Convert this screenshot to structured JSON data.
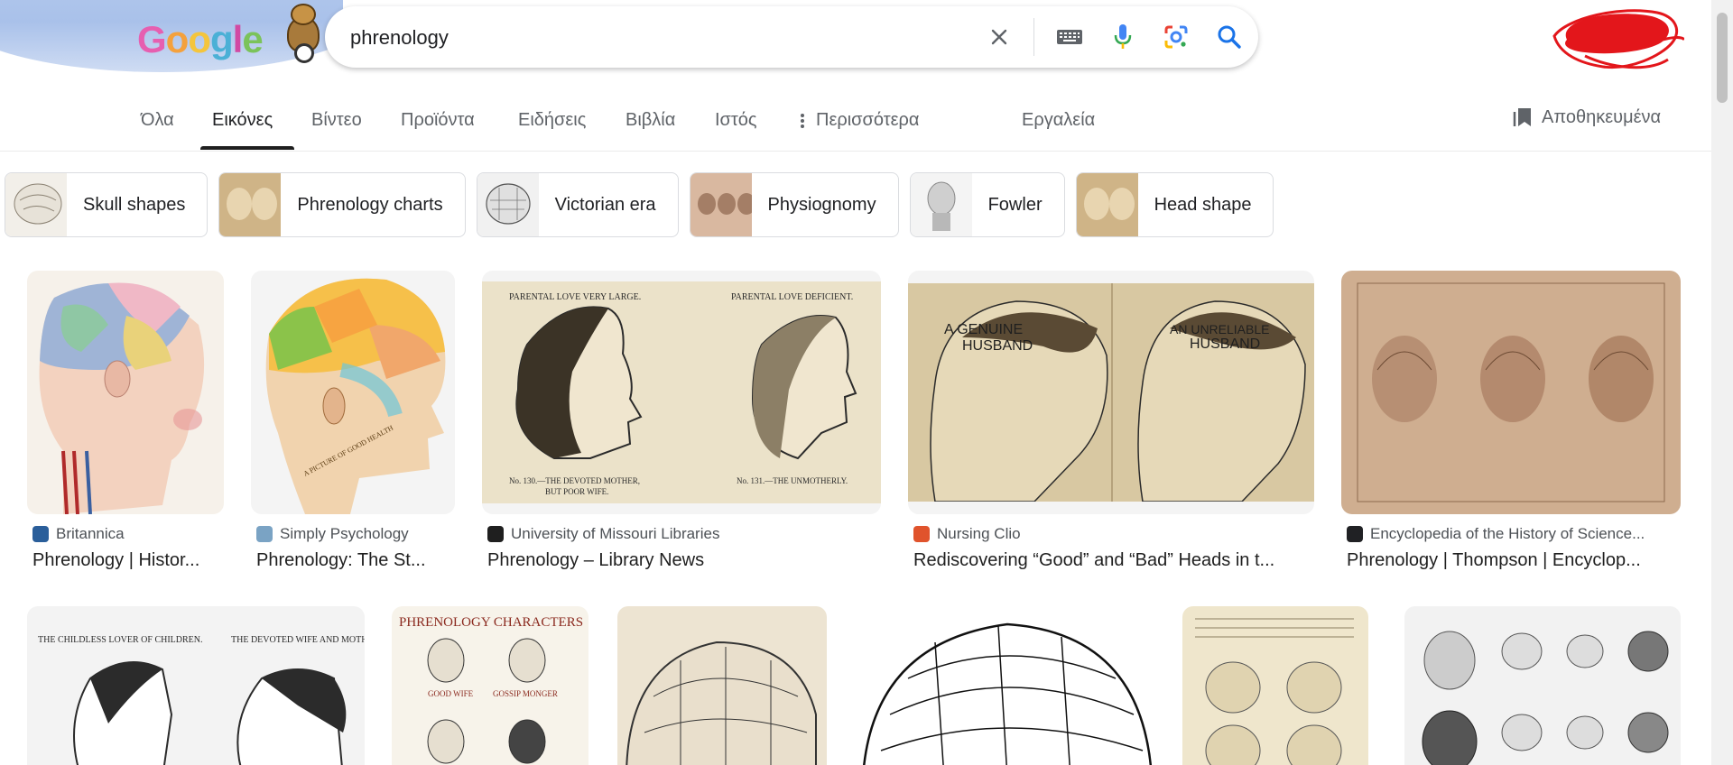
{
  "search": {
    "query": "phrenology",
    "logo_text": [
      "G",
      "o",
      "o",
      "g",
      "l",
      "e"
    ]
  },
  "tabs": [
    {
      "label": "Όλα",
      "active": false
    },
    {
      "label": "Εικόνες",
      "active": true
    },
    {
      "label": "Βίντεο",
      "active": false
    },
    {
      "label": "Προϊόντα",
      "active": false
    },
    {
      "label": "Ειδήσεις",
      "active": false
    },
    {
      "label": "Βιβλία",
      "active": false
    },
    {
      "label": "Ιστός",
      "active": false
    },
    {
      "label": "Περισσότερα",
      "active": false
    },
    {
      "label": "Εργαλεία",
      "active": false
    }
  ],
  "saved_label": "Αποθηκευμένα",
  "chips": [
    "Skull shapes",
    "Phrenology charts",
    "Victorian era",
    "Physiognomy",
    "Fowler",
    "Head shape"
  ],
  "results_row1": [
    {
      "source": "Britannica",
      "title": "Phrenology | Histor...",
      "favicon_color": "#2a5e9a"
    },
    {
      "source": "Simply Psychology",
      "title": "Phrenology: The St...",
      "favicon_color": "#7aa3c4"
    },
    {
      "source": "University of Missouri Libraries",
      "title": "Phrenology – Library News",
      "favicon_color": "#1f1f1f"
    },
    {
      "source": "Nursing Clio",
      "title": "Rediscovering “Good” and “Bad” Heads in t...",
      "favicon_color": "#e0532c"
    },
    {
      "source": "Encyclopedia of the History of Science...",
      "title": "Phrenology | Thompson | Encyclop...",
      "favicon_color": "#202124"
    }
  ],
  "image_text": {
    "parental_large": "PARENTAL LOVE VERY LARGE.",
    "parental_deficient": "PARENTAL LOVE DEFICIENT.",
    "caption_130": "No. 130.—THE DEVOTED MOTHER,",
    "caption_130b": "BUT POOR WIFE.",
    "caption_131": "No. 131.—THE UNMOTHERLY.",
    "genuine": "A GENUINE",
    "husband1": "HUSBAND",
    "unreliable": "AN UNRELIABLE",
    "husband2": "HUSBAND",
    "childless": "THE CHILDLESS LOVER OF CHILDREN.",
    "devoted_wife": "THE DEVOTED WIFE AND MOTHER",
    "characters_title": "PHRENOLOGY CHARACTERS",
    "good_wife": "GOOD WIFE",
    "gossip": "GOSSIP MONGER",
    "pictures_of_health": "A PICTURE OF GOOD HEALTH"
  },
  "colors": {
    "accent": "#1a73e8",
    "tab_underline": "#1f1f1f"
  }
}
